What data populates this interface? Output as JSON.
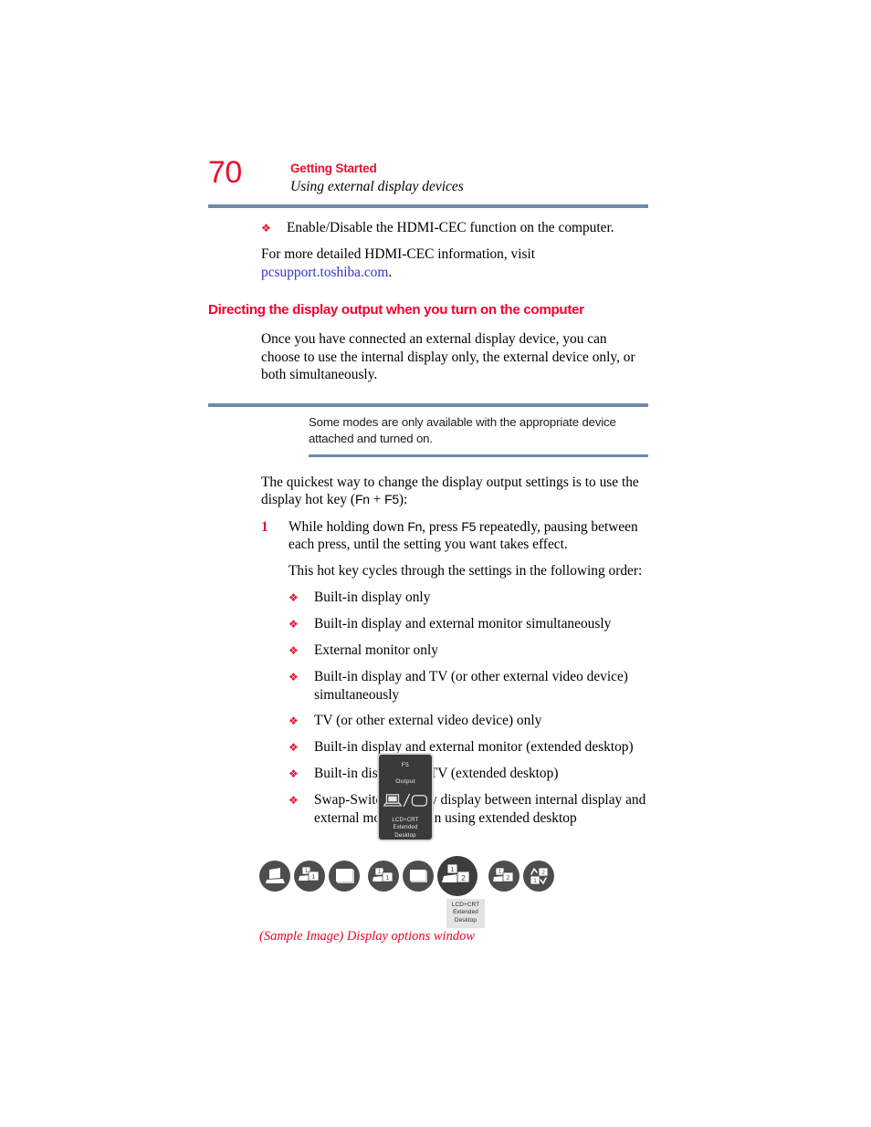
{
  "header": {
    "page_number": "70",
    "chapter": "Getting Started",
    "section": "Using external display devices"
  },
  "intro": {
    "bullet_glyph": "❖",
    "bullet_text": "Enable/Disable the HDMI-CEC function on the computer.",
    "para_prefix": "For more detailed HDMI-CEC information, visit",
    "link_text": "pcsupport.toshiba.com",
    "para_suffix": "."
  },
  "section_heading": "Directing the display output when you turn on the computer",
  "section_paragraph": "Once you have connected an external display device, you can choose to use the internal display only, the external device only, or both simultaneously.",
  "note": {
    "text": "Some modes are only available with the appropriate device attached and turned on."
  },
  "hotkey_paragraph": {
    "part1": "The quickest way to change the display output settings is to use the display hot key (",
    "key1": "Fn",
    "plus": " + ",
    "key2": "F5",
    "part2": "):"
  },
  "step": {
    "number": "1",
    "part1": "While holding down ",
    "key1": "Fn",
    "part2": ", press ",
    "key2": "F5",
    "part3": " repeatedly, pausing between each press, until the setting you want takes effect."
  },
  "cycle_intro": "This hot key cycles through the settings in the following order:",
  "modes": [
    "Built-in display only",
    "Built-in display and external monitor simultaneously",
    "External monitor only",
    "Built-in display and TV (or other external video device) simultaneously",
    "TV (or other external video device) only",
    "Built-in display and external monitor (extended desktop)",
    "Built-in display and TV (extended desktop)",
    "Swap-Switch primary display between internal display and external monitor when using extended desktop"
  ],
  "figure": {
    "osd_panel": {
      "key_label": "F5",
      "function_label": "Output",
      "mode_line1": "LCD+CRT",
      "mode_line2": "Extended",
      "mode_line3": "Desktop"
    },
    "icons": [
      {
        "name": "lcd-only-icon",
        "selected": false
      },
      {
        "name": "lcd-plus-crt-clone-icon",
        "selected": false
      },
      {
        "name": "crt-only-icon",
        "selected": false
      },
      {
        "name": "lcd-plus-tv-clone-icon",
        "selected": false
      },
      {
        "name": "tv-only-icon",
        "selected": false
      },
      {
        "name": "lcd-crt-extended-desktop-icon",
        "selected": true
      },
      {
        "name": "lcd-tv-extended-desktop-icon",
        "selected": false
      },
      {
        "name": "swap-switch-primary-display-icon",
        "selected": false
      }
    ],
    "tooltip": {
      "line1": "LCD+CRT",
      "line2": "Extended",
      "line3": "Desktop"
    },
    "caption": "(Sample Image) Display options window"
  },
  "colors": {
    "accent_red": "#e8112d",
    "heading_red": "#f5002f",
    "rule_blue_gray": "#7089a8",
    "link_blue": "#3333cc",
    "icon_gray": "#4d4d4d"
  }
}
